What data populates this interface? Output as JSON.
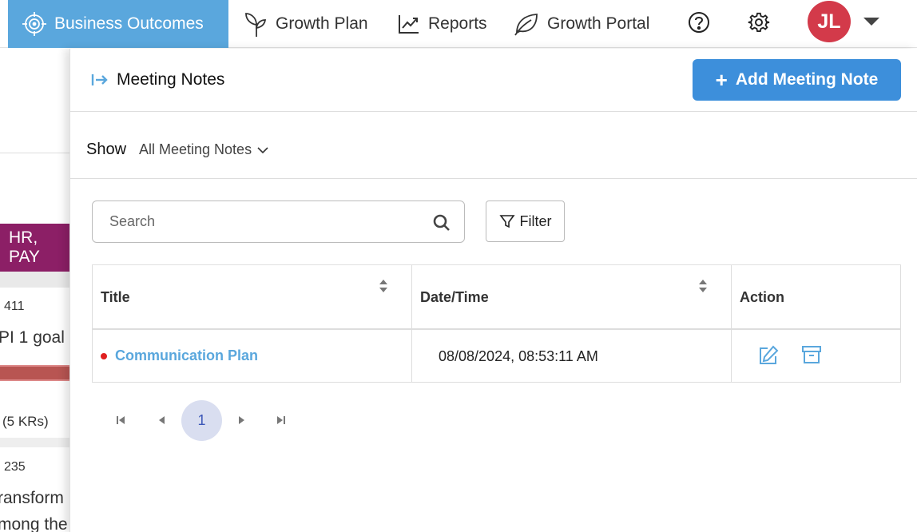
{
  "nav": {
    "items": [
      {
        "label": "Business Outcomes",
        "icon": "target-icon",
        "active": true
      },
      {
        "label": "Growth Plan",
        "icon": "sprout-icon"
      },
      {
        "label": "Reports",
        "icon": "trend-chart-icon"
      },
      {
        "label": "Growth Portal",
        "icon": "leaf-icon"
      }
    ],
    "avatar_initials": "JL",
    "accent_color": "#5aa7dd",
    "avatar_color": "#d33a4a"
  },
  "background": {
    "banner": "HR, PAY",
    "num1": "411",
    "goal_text": "PI 1 goal",
    "krs_text": "(5 KRs)",
    "num2": "235",
    "text1": "ransform",
    "text2": "mong the"
  },
  "panel": {
    "title": "Meeting Notes",
    "add_button": "Add Meeting Note",
    "add_button_color": "#3d8fdb",
    "show_label": "Show",
    "show_value": "All Meeting Notes",
    "search_placeholder": "Search",
    "filter_label": "Filter",
    "table": {
      "columns": [
        "Title",
        "Date/Time",
        "Action"
      ],
      "rows": [
        {
          "title": "Communication Plan",
          "datetime": "08/08/2024, 08:53:11 AM"
        }
      ]
    },
    "pagination": {
      "current_page": "1"
    }
  }
}
